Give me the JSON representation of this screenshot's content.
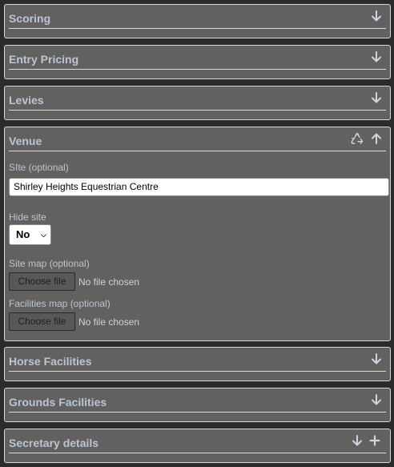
{
  "panels": {
    "scoring": {
      "title": "Scoring",
      "icon": "arrow-down-icon"
    },
    "entry_pricing": {
      "title": "Entry Pricing",
      "icon": "arrow-down-icon"
    },
    "levies": {
      "title": "Levies",
      "icon": "arrow-down-icon"
    },
    "venue": {
      "title": "Venue",
      "icons": [
        "recycle-icon",
        "arrow-up-icon"
      ],
      "site_label": "SIte (optional)",
      "site_value": "Shirley Heights Equestrian Centre",
      "hide_site_label": "Hide site",
      "hide_site_value": "No",
      "site_map_label": "Site map (optional)",
      "site_map_button": "Choose file",
      "site_map_status": "No file chosen",
      "facilities_map_label": "Facilities map (optional)",
      "facilities_map_button": "Choose file",
      "facilities_map_status": "No file chosen"
    },
    "horse_facilities": {
      "title": "Horse Facilities",
      "icon": "arrow-down-icon"
    },
    "grounds_facilities": {
      "title": "Grounds Facilities",
      "icon": "arrow-down-icon"
    },
    "secretary_details": {
      "title": "Secretary details",
      "icons": [
        "arrow-down-icon",
        "plus-icon"
      ]
    }
  },
  "colors": {
    "background": "#2b2b2b",
    "panel": "#636060",
    "heading_text": "#b9c6d4",
    "border": "#d8d8d8"
  }
}
